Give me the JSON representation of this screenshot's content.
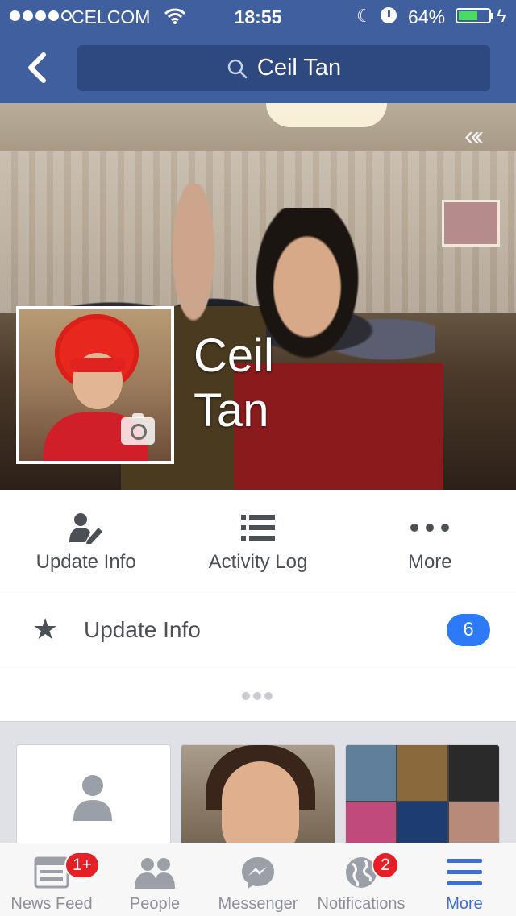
{
  "status_bar": {
    "carrier": "CELCOM",
    "time": "18:55",
    "battery_percent": "64%",
    "battery_level": 0.64,
    "signal_bars": 4
  },
  "nav": {
    "search_text": "Ceil Tan"
  },
  "profile": {
    "name_first": "Ceil",
    "name_last": "Tan"
  },
  "actions": [
    {
      "label": "Update Info",
      "icon": "person-edit-icon"
    },
    {
      "label": "Activity Log",
      "icon": "list-icon"
    },
    {
      "label": "More",
      "icon": "more-dots-icon"
    }
  ],
  "update_row": {
    "label": "Update Info",
    "count": "6"
  },
  "tabs": [
    {
      "label": "News Feed",
      "icon": "news-feed-icon",
      "badge": "1+"
    },
    {
      "label": "People",
      "icon": "people-icon",
      "badge": ""
    },
    {
      "label": "Messenger",
      "icon": "messenger-icon",
      "badge": ""
    },
    {
      "label": "Notifications",
      "icon": "globe-icon",
      "badge": "2"
    },
    {
      "label": "More",
      "icon": "menu-icon",
      "badge": ""
    }
  ],
  "colors": {
    "brand": "#3f5f9e",
    "badge_blue": "#2d7af6",
    "badge_red": "#e61f26",
    "active_tab": "#3b6fd1"
  }
}
